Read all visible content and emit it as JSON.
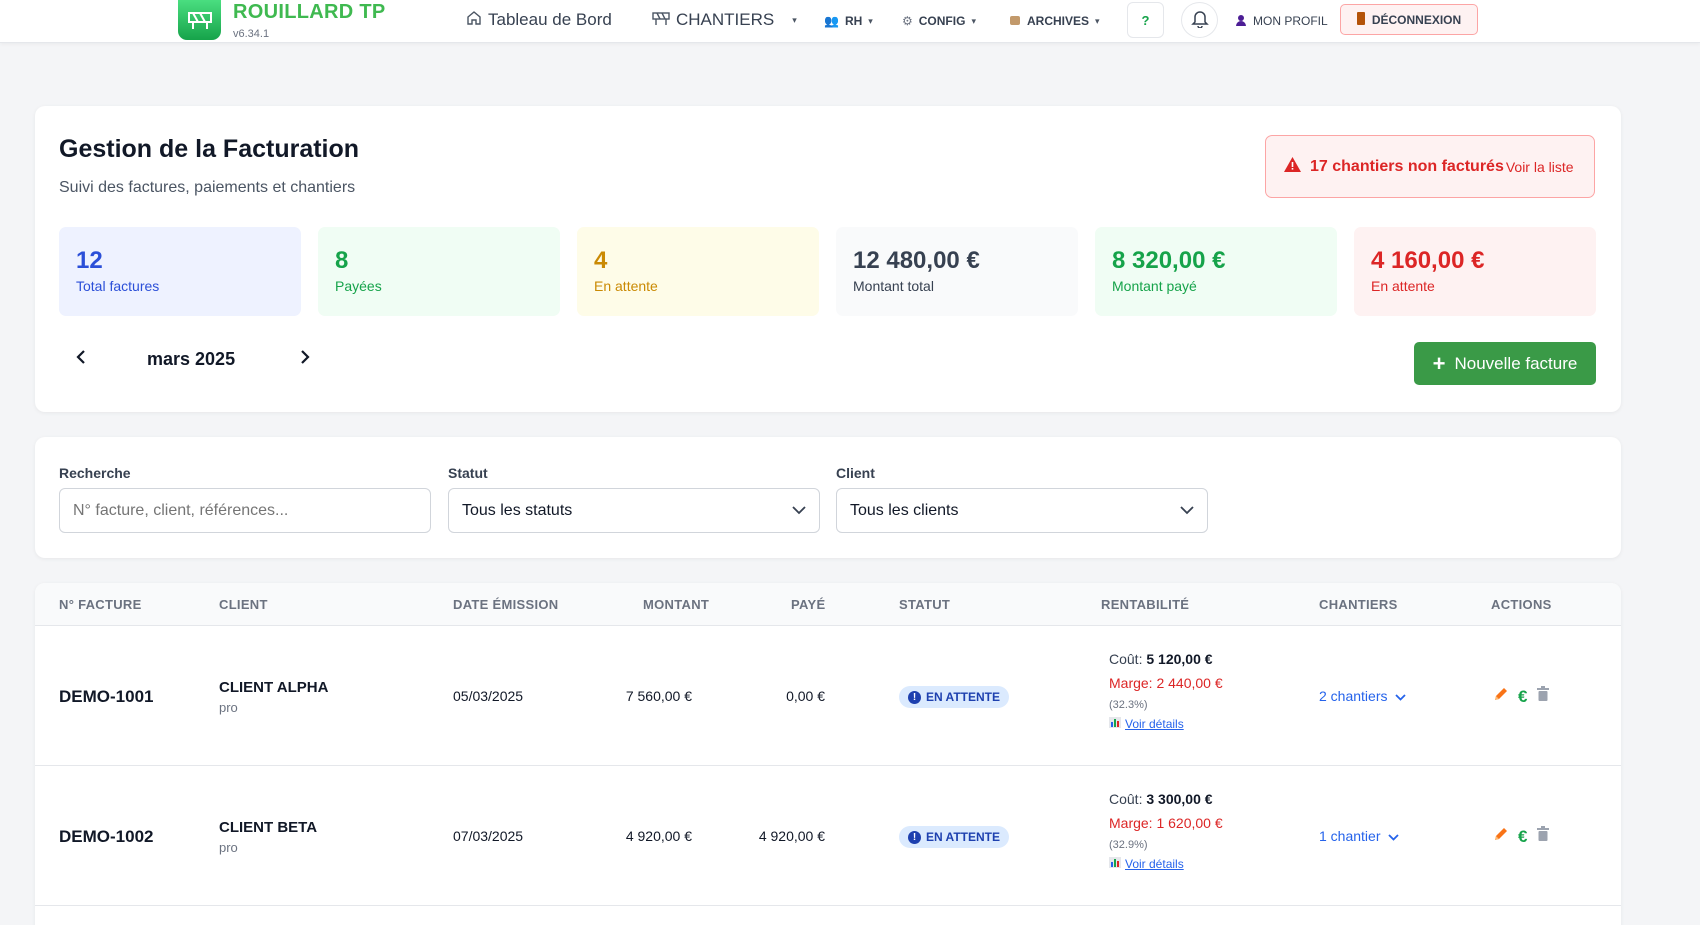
{
  "nav": {
    "brand": "ROUILLARD TP",
    "version": "v6.34.1",
    "dashboard": "Tableau de Bord",
    "chantiers": "CHANTIERS",
    "rh": "RH",
    "config": "CONFIG",
    "archives": "ARCHIVES",
    "help": "?",
    "profile": "MON PROFIL",
    "logout": "DÉCONNEXION"
  },
  "header": {
    "title": "Gestion de la Facturation",
    "subtitle": "Suivi des factures, paiements et chantiers",
    "alert_text": "17 chantiers non facturés",
    "alert_link": "Voir la liste"
  },
  "stats": [
    {
      "value": "12",
      "label": "Total factures",
      "color": "#2b4fd8",
      "bg": "#eef2ff"
    },
    {
      "value": "8",
      "label": "Payées",
      "color": "#16a34a",
      "bg": "#f0fdf4"
    },
    {
      "value": "4",
      "label": "En attente",
      "color": "#ca8a04",
      "bg": "#fefce8"
    },
    {
      "value": "12 480,00 €",
      "label": "Montant total",
      "color": "#374151",
      "bg": "#f9fafb"
    },
    {
      "value": "8 320,00 €",
      "label": "Montant payé",
      "color": "#16a34a",
      "bg": "#f0fdf4"
    },
    {
      "value": "4 160,00 €",
      "label": "En attente",
      "color": "#dc2626",
      "bg": "#fef2f2"
    }
  ],
  "period": {
    "month": "mars 2025"
  },
  "new_invoice": "Nouvelle facture",
  "filters": {
    "search_label": "Recherche",
    "search_placeholder": "N° facture, client, références...",
    "status_label": "Statut",
    "status_value": "Tous les statuts",
    "client_label": "Client",
    "client_value": "Tous les clients"
  },
  "table": {
    "headers": [
      "N° FACTURE",
      "CLIENT",
      "DATE ÉMISSION",
      "MONTANT",
      "PAYÉ",
      "STATUT",
      "RENTABILITÉ",
      "CHANTIERS",
      "ACTIONS"
    ],
    "rows": [
      {
        "invoice": "DEMO-1001",
        "client": "CLIENT ALPHA",
        "client_type": "pro",
        "date": "05/03/2025",
        "amount": "7 560,00 €",
        "paid": "0,00 €",
        "status": "EN ATTENTE",
        "cost_label": "Coût:",
        "cost": "5 120,00 €",
        "margin": "Marge: 2 440,00 €",
        "margin_pct": "(32.3%)",
        "details": "Voir détails",
        "sites": "2 chantiers"
      },
      {
        "invoice": "DEMO-1002",
        "client": "CLIENT BETA",
        "client_type": "pro",
        "date": "07/03/2025",
        "amount": "4 920,00 €",
        "paid": "4 920,00 €",
        "status": "EN ATTENTE",
        "cost_label": "Coût:",
        "cost": "3 300,00 €",
        "margin": "Marge: 1 620,00 €",
        "margin_pct": "(32.9%)",
        "details": "Voir détails",
        "sites": "1 chantier"
      }
    ]
  }
}
